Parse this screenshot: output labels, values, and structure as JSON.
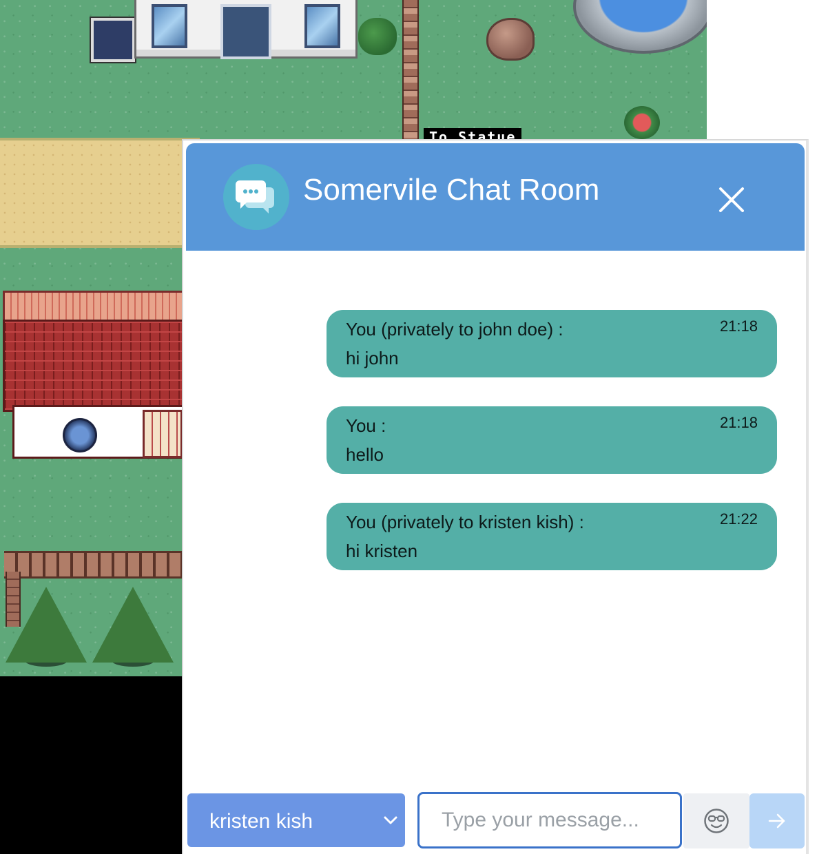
{
  "game": {
    "status_label": "To Statue"
  },
  "chat": {
    "title": "Somervile Chat Room",
    "messages": [
      {
        "sender": "You (privately to john doe) :",
        "text": "hi john",
        "time": "21:18"
      },
      {
        "sender": "You :",
        "text": "hello",
        "time": "21:18"
      },
      {
        "sender": "You (privately to kristen kish) :",
        "text": "hi kristen",
        "time": "21:22"
      }
    ],
    "recipient": "kristen kish",
    "input_placeholder": "Type your message...",
    "input_value": "",
    "icons": {
      "avatar": "chat-bubbles-icon",
      "close": "close-icon",
      "dropdown": "chevron-down-icon",
      "emoji": "sunglasses-emoji-icon",
      "send": "arrow-right-icon"
    },
    "colors": {
      "header": "#5897d9",
      "bubble": "#54afa7",
      "recipient_select": "#6b95e4",
      "send_button": "#b8d6f7",
      "input_border": "#3a72c9"
    }
  }
}
